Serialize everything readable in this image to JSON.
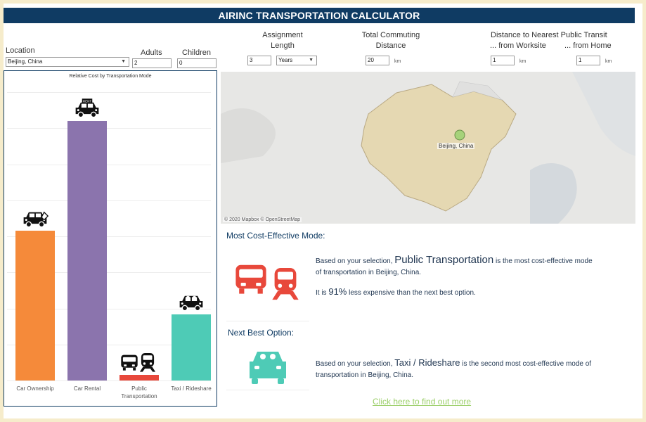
{
  "header": {
    "title": "AIRINC TRANSPORTATION CALCULATOR"
  },
  "filters": {
    "location": {
      "label": "Location",
      "value": "Beijing, China"
    },
    "adults": {
      "label": "Adults",
      "value": "2"
    },
    "children": {
      "label": "Children",
      "value": "0"
    },
    "assignment": {
      "label_line1": "Assignment",
      "label_line2": "Length",
      "value": "3",
      "unit_value": "Years"
    },
    "commute": {
      "label_line1": "Total Commuting",
      "label_line2": "Distance",
      "value": "20",
      "unit": "km"
    },
    "transit": {
      "label": "Distance to Nearest Public Transit",
      "worksite_label": "... from Worksite",
      "home_label": "... from Home",
      "worksite_value": "1",
      "home_value": "1",
      "unit": "km"
    }
  },
  "chart_data": {
    "type": "bar",
    "title": "Relative Cost by Transportation Mode",
    "categories": [
      "Car Ownership",
      "Car Rental",
      "Public\nTransportation",
      "Taxi / Rideshare"
    ],
    "values": [
      52,
      90,
      2,
      23
    ],
    "ylim": [
      0,
      100
    ],
    "colors": [
      "#f58a3a",
      "#8b74ad",
      "#e8483b",
      "#4ecbb6"
    ],
    "icons": [
      "car-with-tag-icon",
      "rent-car-icon",
      "bus-train-icon",
      "taxi-passengers-icon"
    ]
  },
  "map": {
    "marker_label": "Beijing, China",
    "credit": "© 2020 Mapbox  © OpenStreetMap"
  },
  "result": {
    "most_heading": "Most Cost-Effective Mode:",
    "most_prefix": "Based on your selection, ",
    "most_mode": "Public Transportation",
    "most_suffix": " is the most cost-effective mode",
    "most_line2": "of transportation in Beijing, China.",
    "pct_prefix": "It is ",
    "pct_value": "91%",
    "pct_suffix": " less expensive than the next best option.",
    "next_heading": "Next Best Option:",
    "next_prefix": "Based on your selection, ",
    "next_mode": "Taxi / Rideshare",
    "next_suffix": " is the second most cost-effective mode of",
    "next_line2": "transportation in Beijing, China."
  },
  "link": {
    "text": "Click here to find out more"
  }
}
